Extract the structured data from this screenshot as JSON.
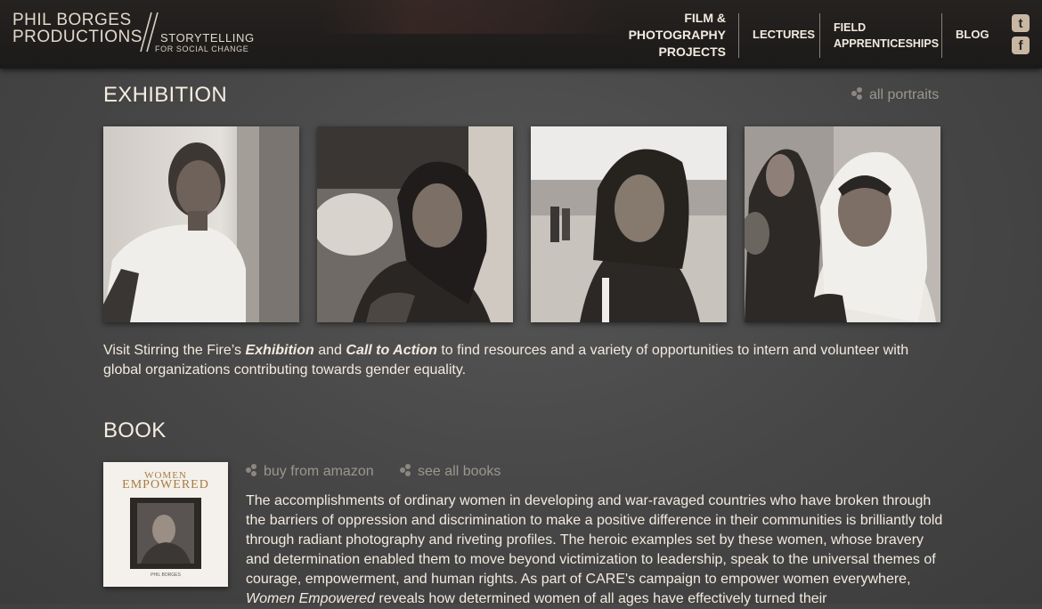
{
  "header": {
    "logo": {
      "line1": "PHIL BORGES",
      "line2": "PRODUCTIONS",
      "tagline1": "STORYTELLING",
      "tagline2": "FOR SOCIAL CHANGE"
    },
    "nav": {
      "film_line1": "FILM &",
      "film_line2": "PHOTOGRAPHY",
      "film_line3": "PROJECTS",
      "lectures": "LECTURES",
      "field_line1": "FIELD",
      "field_line2": "APPRENTICESHIPS",
      "blog": "BLOG"
    },
    "social": {
      "twitter_glyph": "t",
      "facebook_glyph": "f"
    }
  },
  "exhibition": {
    "title": "EXHIBITION",
    "all_portraits": "all portraits",
    "text_pre": "Visit Stirring the Fire’s ",
    "text_exhibition": "Exhibition",
    "text_and": " and ",
    "text_call": "Call to Action",
    "text_post": " to find resources and a variety of opportunities to intern and volunteer with global organizations contributing towards gender equality."
  },
  "book": {
    "title": "BOOK",
    "buy": "buy from amazon",
    "see_all": "see all books",
    "cover_title1": "WOMEN",
    "cover_title2": "EMPOWERED",
    "cover_author": "PHIL BORGES",
    "text_main": "The accomplishments of ordinary women in developing and war-ravaged countries who have broken through the barriers of oppression and discrimination to make a positive difference in their communities is brilliantly told through radiant photography and riveting profiles. The heroic examples set by these women, whose bravery and determination enabled them to move beyond victimization to leadership, speak to the universal themes of courage, empowerment, and human rights. As part of CARE's campaign to empower women everywhere, ",
    "text_italic": "Women Empowered",
    "text_tail": " reveals how determined women of all ages have effectively turned their"
  },
  "colors": {
    "background": "#4a4a4a",
    "header": "#1f1c1b",
    "text": "#f2eadf",
    "muted": "#9c968e"
  }
}
